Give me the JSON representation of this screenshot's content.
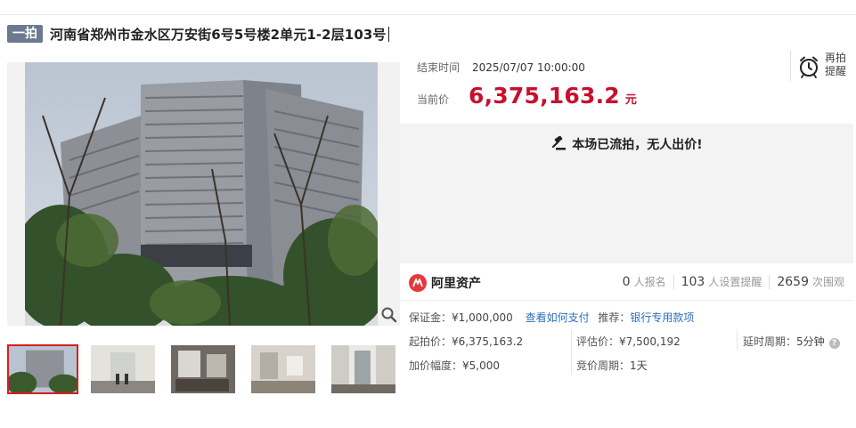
{
  "title": {
    "round_tag": "一拍",
    "lot_name": "河南省郑州市金水区万安街6号5号楼2单元1-2层103号"
  },
  "auction": {
    "end_label": "结束时间",
    "end_value": "2025/07/07 10:00:00",
    "price_label": "当前价",
    "price_value": "6,375,163.2",
    "price_unit": "元",
    "remind_label": "再拍提醒",
    "status_text": "本场已流拍，无人出价!"
  },
  "brand": {
    "name": "阿里资产",
    "accent_color": "#e4393c"
  },
  "stats": [
    {
      "value": "0",
      "unit": "人报名"
    },
    {
      "value": "103",
      "unit": "人设置提醒"
    },
    {
      "value": "2659",
      "unit": "次围观"
    }
  ],
  "details": {
    "deposit_label": "保证金：",
    "deposit_value": "¥1,000,000",
    "how_to_pay": "查看如何支付",
    "recommend_label": "推荐：",
    "recommend_value": "银行专用款项",
    "start_price_label": "起拍价：",
    "start_price_value": "¥6,375,163.2",
    "appraisal_label": "评估价：",
    "appraisal_value": "¥7,500,192",
    "delay_label": "延时周期：",
    "delay_value": "5分钟",
    "increment_label": "加价幅度：",
    "increment_value": "¥5,000",
    "bid_cycle_label": "竞价周期：",
    "bid_cycle_value": "1天"
  },
  "colors": {
    "price_red": "#c8102e",
    "tag_gray": "#6b7b8f",
    "link_blue": "#2c6fbf",
    "thumb_active": "#d81e1e"
  },
  "icons": {
    "zoom": "magnifier-icon",
    "remind": "alarm-clock-icon",
    "status": "gavel-icon",
    "brand": "ali-assets-logo",
    "help": "question-mark-icon"
  }
}
